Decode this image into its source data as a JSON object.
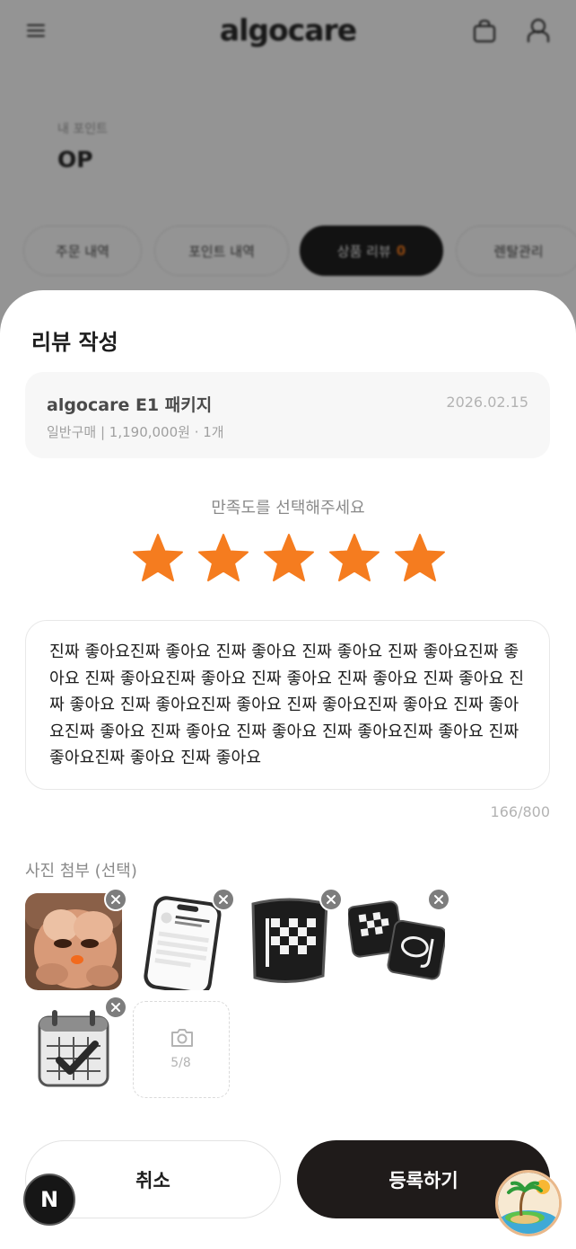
{
  "header": {
    "logo": "algocare",
    "menu_icon": "hamburger-menu-icon",
    "bag_icon": "shopping-bag-icon",
    "user_icon": "user-icon"
  },
  "profile": {
    "label": "내 포인트",
    "name": "OP"
  },
  "tabs": [
    {
      "label": "주문 내역",
      "active": false
    },
    {
      "label": "포인트 내역",
      "active": false
    },
    {
      "label": "상품 리뷰",
      "count": "0",
      "active": true
    },
    {
      "label": "렌탈관리",
      "active": false
    }
  ],
  "sheet": {
    "title": "리뷰 작성",
    "product": {
      "name": "algocare E1 패키지",
      "date": "2026.02.15",
      "meta": "일반구매 | 1,190,000원 · 1개"
    },
    "rating_label": "만족도를 선택해주세요",
    "rating": 5,
    "rating_max": 5,
    "review_text": "진짜 좋아요진짜 좋아요 진짜 좋아요 진짜 좋아요 진짜 좋아요진짜 좋아요 진짜 좋아요진짜 좋아요 진짜 좋아요 진짜 좋아요 진짜 좋아요 진짜 좋아요 진짜 좋아요진짜 좋아요 진짜 좋아요진짜 좋아요 진짜 좋아요진짜 좋아요 진짜 좋아요 진짜 좋아요 진짜 좋아요진짜 좋아요 진짜 좋아요진짜 좋아요 진짜 좋아요",
    "char_count": "166/800",
    "photo_label": "사진 첨부 (선택)",
    "photos": [
      {
        "icon": "plush-toy-photo"
      },
      {
        "icon": "phone-screen-photo"
      },
      {
        "icon": "checkered-flag-patch-photo"
      },
      {
        "icon": "flag-goggles-patches-photo"
      },
      {
        "icon": "calendar-check-photo"
      }
    ],
    "add_photo_count": "5/8",
    "cancel_label": "취소",
    "submit_label": "등록하기"
  },
  "floating": {
    "n_badge": "N",
    "beach_icon": "beach-island-icon"
  },
  "colors": {
    "accent_star": "#F57C1F",
    "primary_button": "#1F1B1A"
  }
}
